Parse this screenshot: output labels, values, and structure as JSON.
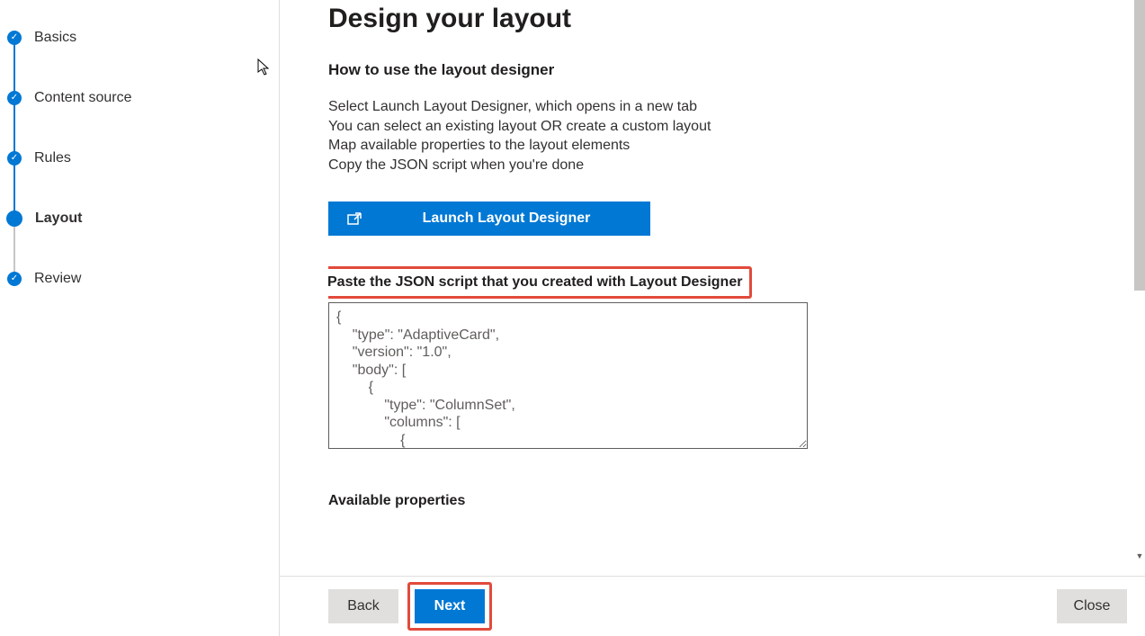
{
  "sidebar": {
    "steps": [
      {
        "label": "Basics",
        "state": "done"
      },
      {
        "label": "Content source",
        "state": "done"
      },
      {
        "label": "Rules",
        "state": "done"
      },
      {
        "label": "Layout",
        "state": "current"
      },
      {
        "label": "Review",
        "state": "done"
      }
    ]
  },
  "main": {
    "title": "Design your layout",
    "how_to_heading": "How to use the layout designer",
    "instructions": [
      "Select Launch Layout Designer, which opens in a new tab",
      "You can select an existing layout OR create a custom layout",
      "Map available properties to the layout elements",
      "Copy the JSON script when you're done"
    ],
    "launch_button": "Launch Layout Designer",
    "json_label": "Paste the JSON script that you created with Layout Designer",
    "json_value": "{\n    \"type\": \"AdaptiveCard\",\n    \"version\": \"1.0\",\n    \"body\": [\n        {\n            \"type\": \"ColumnSet\",\n            \"columns\": [\n                {\n                    \"type\": \"Column\",",
    "available_properties": "Available properties"
  },
  "footer": {
    "back": "Back",
    "next": "Next",
    "close": "Close"
  }
}
